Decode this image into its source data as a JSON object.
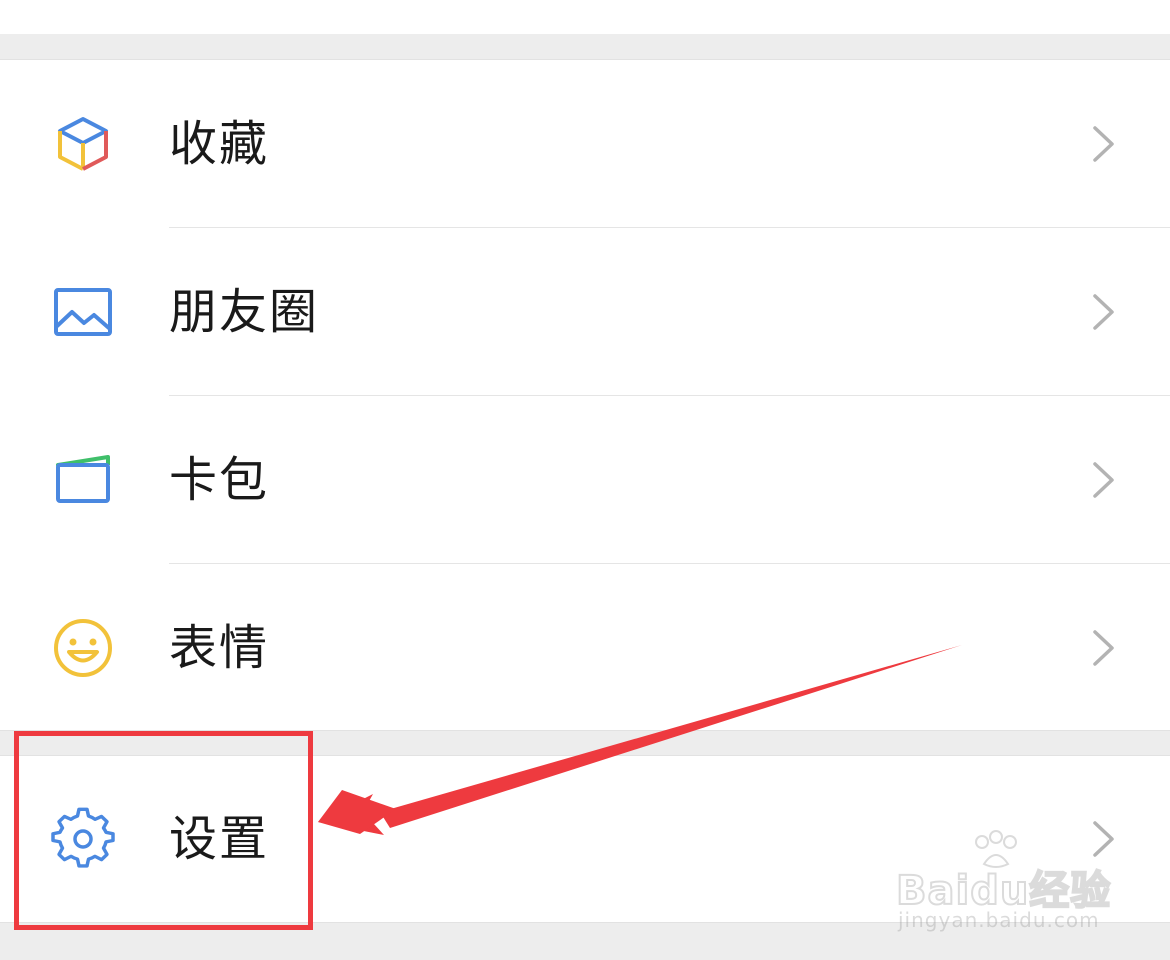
{
  "menu": {
    "items": [
      {
        "label": "收藏",
        "icon": "favorites-cube-icon"
      },
      {
        "label": "朋友圈",
        "icon": "moments-image-icon"
      },
      {
        "label": "卡包",
        "icon": "card-wallet-icon"
      },
      {
        "label": "表情",
        "icon": "sticker-smiley-icon"
      }
    ],
    "settings": {
      "label": "设置",
      "icon": "gear-icon"
    }
  },
  "annotation": {
    "highlight_color": "#ee3a3f",
    "arrow_color": "#ee3a3f"
  },
  "watermark": {
    "logo_text": "Baidu经验",
    "url": "jingyan.baidu.com"
  },
  "colors": {
    "background": "#ededed",
    "row_background": "#ffffff",
    "text": "#1a1a1a",
    "icon_blue": "#4a88e0",
    "chevron": "#b3b3b3"
  }
}
